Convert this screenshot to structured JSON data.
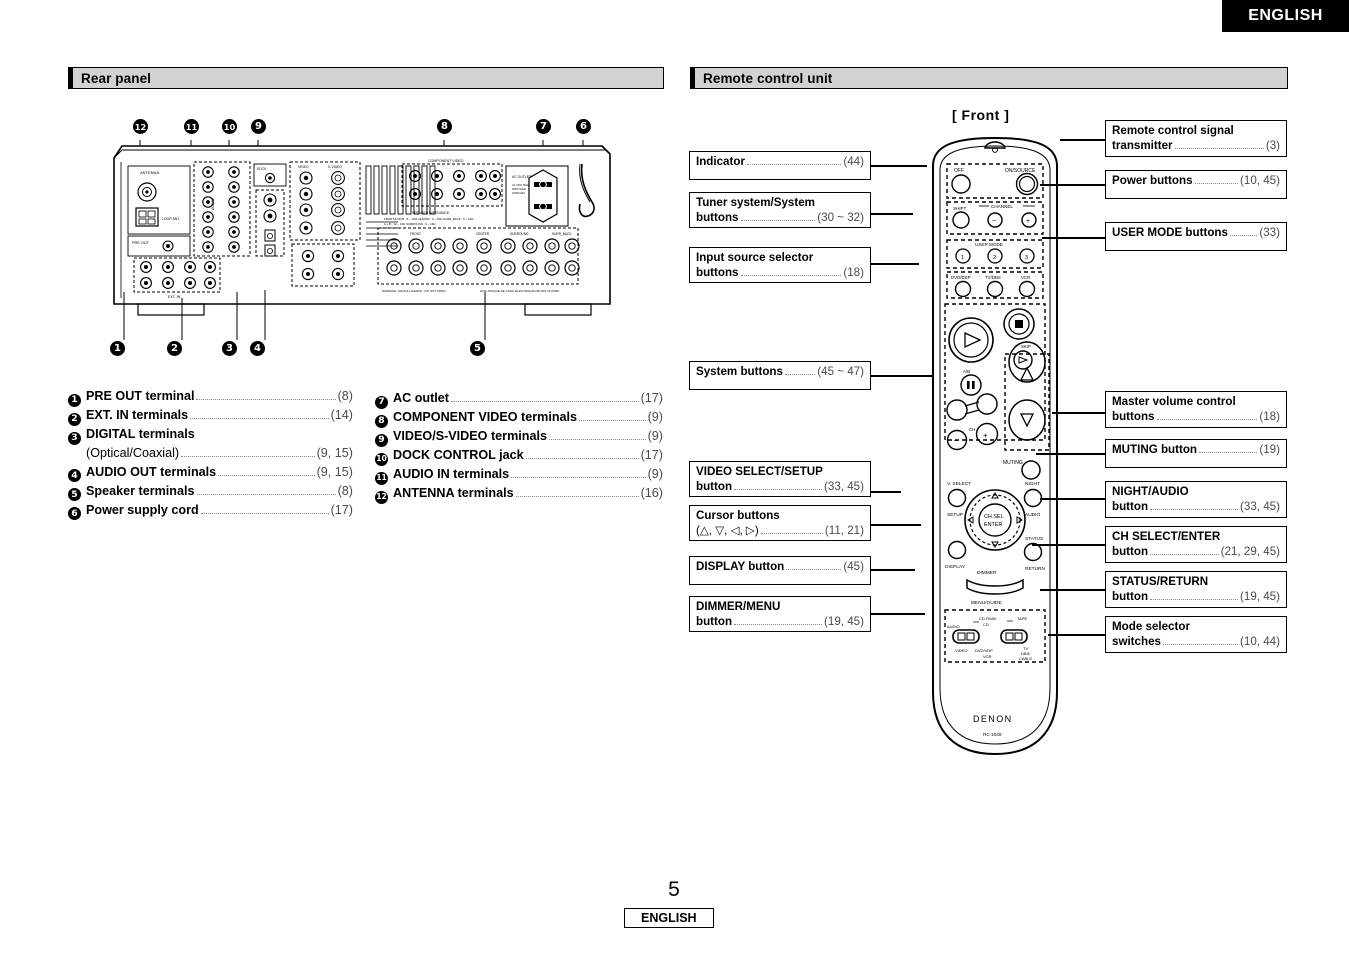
{
  "header": {
    "language_tab": "ENGLISH"
  },
  "sections": {
    "rear_panel": {
      "title": "Rear panel"
    },
    "remote": {
      "title": "Remote control unit",
      "view_label": "[ Front ]"
    }
  },
  "rear_panel_figure": {
    "callout_numbers_top": [
      "12",
      "11",
      "10",
      "9",
      "8",
      "7",
      "6"
    ],
    "callout_numbers_bottom": [
      "1",
      "2",
      "3",
      "4",
      "5"
    ]
  },
  "legend_left": [
    {
      "num": "1",
      "label": "PRE OUT terminal",
      "page": "(8)"
    },
    {
      "num": "2",
      "label": "EXT. IN terminals",
      "page": "(14)"
    },
    {
      "num": "3",
      "label": "DIGITAL terminals",
      "page": "",
      "sub_label": "(Optical/Coaxial)",
      "sub_page": "(9, 15)"
    },
    {
      "num": "4",
      "label": "AUDIO OUT terminals",
      "page": "(9, 15)"
    },
    {
      "num": "5",
      "label": "Speaker terminals",
      "page": "(8)"
    },
    {
      "num": "6",
      "label": "Power supply cord",
      "page": "(17)"
    }
  ],
  "legend_right": [
    {
      "num": "7",
      "label": "AC outlet",
      "page": "(17)"
    },
    {
      "num": "8",
      "label": "COMPONENT VIDEO terminals",
      "page": "(9)"
    },
    {
      "num": "9",
      "label": "VIDEO/S-VIDEO terminals",
      "page": "(9)"
    },
    {
      "num": "10",
      "label": "DOCK CONTROL jack",
      "page": "(17)"
    },
    {
      "num": "11",
      "label": "AUDIO IN terminals",
      "page": "(9)"
    },
    {
      "num": "12",
      "label": "ANTENNA terminals",
      "page": "(16)"
    }
  ],
  "callouts_left": [
    {
      "line1": "Indicator",
      "line2": "",
      "page": "(44)"
    },
    {
      "line1": "Tuner system/System",
      "line2": "buttons",
      "page": "(30 ~ 32)"
    },
    {
      "line1": "Input source selector",
      "line2": "buttons",
      "page": "(18)"
    },
    {
      "line1": "System buttons",
      "line2": "",
      "page": "(45 ~ 47)"
    },
    {
      "line1": "VIDEO SELECT/SETUP",
      "line2": "button",
      "page": "(33, 45)"
    },
    {
      "line1": "Cursor buttons",
      "line2": "(△, ▽, ◁, ▷)",
      "page": "(11, 21)"
    },
    {
      "line1": "DISPLAY button",
      "line2": "",
      "page": "(45)"
    },
    {
      "line1": "DIMMER/MENU",
      "line2": "button",
      "page": "(19, 45)"
    }
  ],
  "callouts_right": [
    {
      "line1": "Remote control signal",
      "line2": "transmitter",
      "page": "(3)"
    },
    {
      "line1": "Power buttons",
      "line2": "",
      "page": "(10, 45)"
    },
    {
      "line1": "USER MODE buttons",
      "line2": "",
      "page": "(33)"
    },
    {
      "line1": "Master volume control",
      "line2": "buttons",
      "page": "(18)"
    },
    {
      "line1": "MUTING button",
      "line2": "",
      "page": "(19)"
    },
    {
      "line1": "NIGHT/AUDIO",
      "line2": "button",
      "page": "(33, 45)"
    },
    {
      "line1": "CH SELECT/ENTER",
      "line2": "button",
      "page": "(21, 29, 45)"
    },
    {
      "line1": "STATUS/RETURN",
      "line2": "button",
      "page": "(19, 45)"
    },
    {
      "line1": "Mode selector",
      "line2": "switches",
      "page": "(10, 44)"
    }
  ],
  "remote_figure": {
    "brand": "DENON",
    "model": "RC-1049",
    "power_off": "OFF",
    "power_on": "ON/SOURCE",
    "shift": "SHIFT",
    "channel": "CHANNEL",
    "channel_minus": "−",
    "channel_plus": "+",
    "user_mode": "USER MODE",
    "user_mode_buttons": [
      "1",
      "2",
      "3"
    ],
    "source_buttons": [
      "DVD/DSP",
      "TV/DBS",
      "VCR"
    ],
    "skip": "SKIP",
    "ab": "A/B",
    "ch": "CH",
    "muting": "MUTING",
    "v_select": "V. SELECT",
    "setup": "SETUP",
    "night": "NIGHT",
    "audio": "AUDIO",
    "ch_sel": "CH SEL",
    "enter": "ENTER",
    "display": "DISPLAY",
    "status": "STATUS",
    "return": "RETURN",
    "dimmer": "DIMMER",
    "menu_guide": "MENU/GUIDE",
    "mode_audio": "AUDIO",
    "mode_cdr_md": "CD-R/MD",
    "mode_cd": "CD",
    "mode_tape": "TAPE",
    "mode_video": "VIDEO",
    "mode_dvd_vdp": "DVD/VDP",
    "mode_vcr": "VCR",
    "mode_tv_dbs_cable": "TV DBS/ CABLE"
  },
  "rear_figure_labels": {
    "antenna": "ANTENNA",
    "pre_out": "PRE OUT",
    "ext_in": "EXT. IN",
    "audio": "AUDIO",
    "digital": "DIGITAL",
    "video_svideo": "VIDEO / S-VIDEO",
    "component_video": "COMPONENT VIDEO",
    "speaker_impedance": "SPEAKER IMPEDANCE",
    "front": "FRONT",
    "center": "CENTER",
    "surround": "SURROUND",
    "surr_back": "SURR. BACK",
    "ac_outlet": "AC OUTLET",
    "ac_rating": "AC 230V 50Hz SWITCHED 100W MAX.",
    "warning": "WARNING: SHOCK HAZARD - DO NOT OPEN.",
    "warning_fr": "AVIS: RISQUE DE CHOC ELECTRIQUE-NE PAS OUVRIR.",
    "dock_control": "DOCK CONTROL"
  },
  "footer": {
    "page_number": "5",
    "language": "ENGLISH"
  }
}
